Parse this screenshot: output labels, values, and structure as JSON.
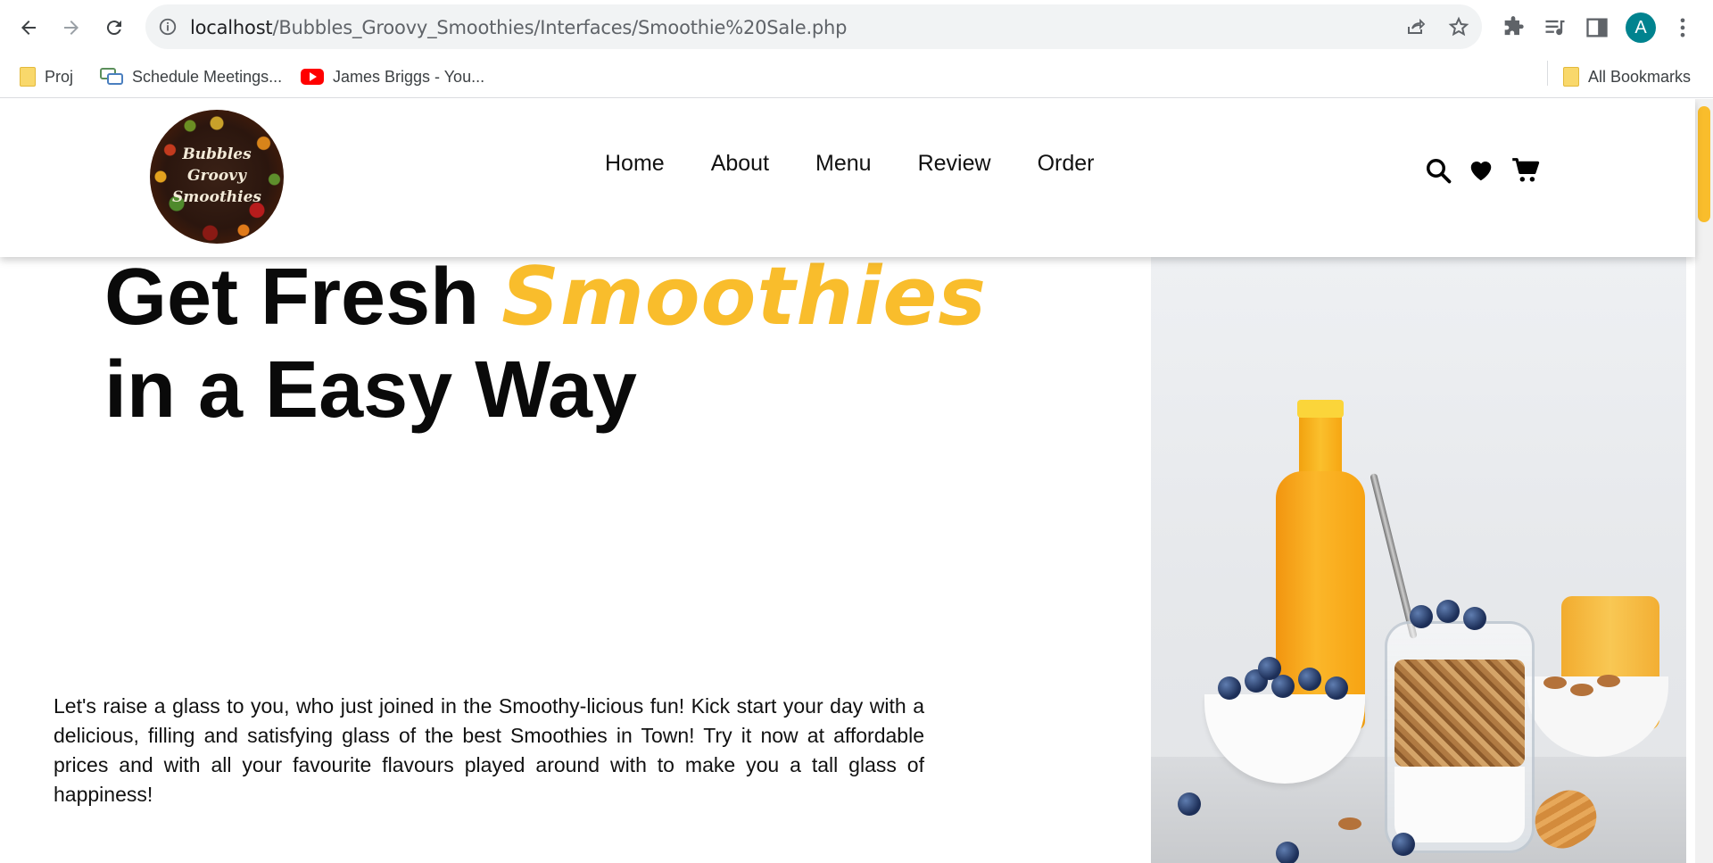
{
  "browser": {
    "url_host": "localhost",
    "url_path": "/Bubbles_Groovy_Smoothies/Interfaces/Smoothie%20Sale.php",
    "avatar_letter": "A",
    "bookmarks": [
      {
        "label": "Proj",
        "icon": "folder-icon"
      },
      {
        "label": "Schedule Meetings...",
        "icon": "meeting-icon"
      },
      {
        "label": "James Briggs - You...",
        "icon": "youtube-icon"
      }
    ],
    "all_bookmarks_label": "All Bookmarks"
  },
  "site": {
    "logo_text": [
      "Bubbles",
      "Groovy",
      "Smoothies"
    ],
    "nav": [
      "Home",
      "About",
      "Menu",
      "Review",
      "Order"
    ],
    "header_icons": [
      "search-icon",
      "heart-icon",
      "cart-icon"
    ]
  },
  "hero": {
    "title_part1": "Get Fresh ",
    "title_accent": "Smoothies",
    "title_part2": "in a Easy Way",
    "description": "Let's raise a glass to you, who just joined in the Smoothy-licious fun! Kick start your day with a delicious, filling and satisfying glass of the best Smoothies in Town! Try it now at affordable prices and with all your favourite flavours played around with to make you a tall glass of happiness!"
  },
  "colors": {
    "accent": "#f9bd2c",
    "text": "#0a0a0a",
    "avatar": "#00838f"
  }
}
